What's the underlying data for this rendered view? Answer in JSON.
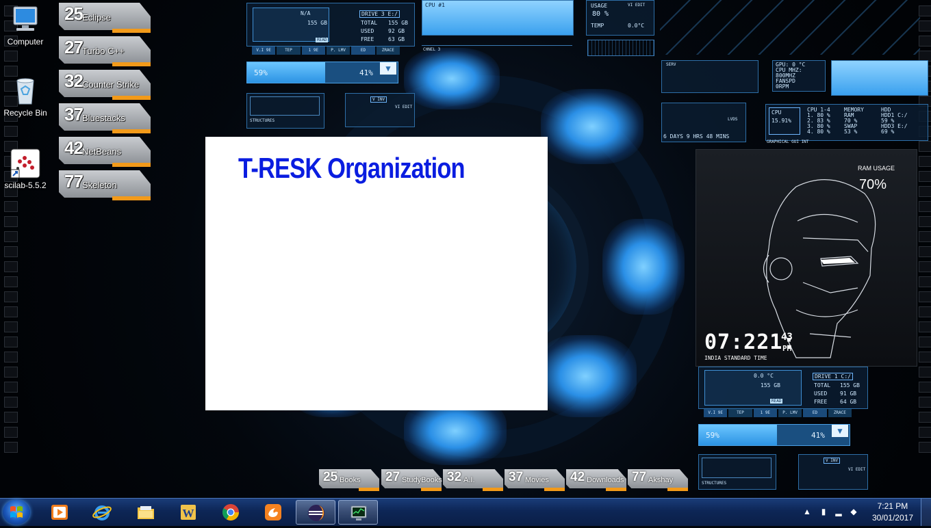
{
  "desktop_icons": [
    {
      "label": "Computer",
      "icon": "computer-icon"
    },
    {
      "label": "Recycle Bin",
      "icon": "recycle-bin-icon"
    },
    {
      "label": "scilab-5.5.2",
      "icon": "scilab-icon"
    }
  ],
  "left_tiles": [
    {
      "num": "25",
      "label": "Eclipse"
    },
    {
      "num": "27",
      "label": "Turbo C++"
    },
    {
      "num": "32",
      "label": "Counter Strike"
    },
    {
      "num": "37",
      "label": "Bluestacks"
    },
    {
      "num": "42",
      "label": "NetBeans"
    },
    {
      "num": "77",
      "label": "Skeleton"
    }
  ],
  "bottom_tiles": [
    {
      "num": "25",
      "label": "Books"
    },
    {
      "num": "27",
      "label": "StudyBooks"
    },
    {
      "num": "32",
      "label": "A.I."
    },
    {
      "num": "37",
      "label": "Movies"
    },
    {
      "num": "42",
      "label": "Downloads"
    },
    {
      "num": "77",
      "label": "Akshay"
    }
  ],
  "window": {
    "title": "T-RESK Organization"
  },
  "hud_top": {
    "drive": {
      "name": "DRIVE 3  E:/",
      "temp": "N/A",
      "size": "155 GB",
      "total_label": "TOTAL",
      "total": "155 GB",
      "used_label": "USED",
      "used": "92 GB",
      "free_label": "FREE",
      "free": "63 GB",
      "read": "READ"
    },
    "tabs": [
      "V.I 9E",
      "TEP",
      "1 9E",
      "P. LMV",
      "ED",
      "ZRACE"
    ],
    "bar_left": "59%",
    "bar_right": "41%",
    "structures": "STRUCTURES",
    "vi_inv": "V INV",
    "vi_edit": "VI EDIT",
    "cpu_label": "CPU #1",
    "channel": "CHNEL 3",
    "usage_label": "USAGE",
    "usage": "80 %",
    "temp_label": "TEMP",
    "temp": "0.0°C",
    "usage_vi": "VI EDIT"
  },
  "hud_right": {
    "gpu": [
      "GPU: 0 °C",
      "CPU MHZ:",
      "800MHZ",
      "FANSPD",
      "0RPM"
    ],
    "serv": "SERV",
    "uptime": "6 DAYS  9 HRS 48 MINS",
    "lvds": "LVDS",
    "cpu_label": "CPU",
    "cpu_value": "15.91%",
    "cores": [
      "CPU 1-4",
      "1.  80 %",
      "2.  83 %",
      "3.  80 %",
      "4.  80 %"
    ],
    "memory": [
      "MEMORY",
      "RAM",
      "70  %",
      "SWAP",
      "53  %"
    ],
    "hdd": [
      "HDD",
      "HDD1 C:/",
      "59  %",
      "HDD3 E:/",
      "69  %"
    ],
    "graphical": "GRAPHICAL GUI INT"
  },
  "ironman": {
    "ram_label": "RAM USAGE",
    "ram_value": "70%",
    "time_h": "07:2",
    "time_m": "21:",
    "time_s": "43",
    "ampm": "PM",
    "tz": "INDIA STANDARD TIME"
  },
  "hud_bottom": {
    "drive": {
      "name": "DRIVE 1  C:/",
      "temp": "0.0 °C",
      "size": "155 GB",
      "total_label": "TOTAL",
      "total": "155 GB",
      "used_label": "USED",
      "used": "91 GB",
      "free_label": "FREE",
      "free": "64 GB",
      "read": "READ"
    },
    "tabs": [
      "V.I 9E",
      "TEP",
      "1 9E",
      "P. LMV",
      "ED",
      "ZRACE"
    ],
    "bar_left": "59%",
    "bar_right": "41%",
    "structures": "STRUCTURES",
    "vi_inv": "V INV",
    "vi_edit": "VI EDIT"
  },
  "taskbar": {
    "pinned": [
      {
        "icon": "windows-media-player-icon"
      },
      {
        "icon": "internet-explorer-icon"
      },
      {
        "icon": "file-explorer-icon"
      },
      {
        "icon": "microsoft-word-icon"
      },
      {
        "icon": "chrome-icon"
      },
      {
        "icon": "uc-browser-icon"
      },
      {
        "icon": "eclipse-icon"
      },
      {
        "icon": "task-manager-icon"
      }
    ],
    "time": "7:21 PM",
    "date": "30/01/2017"
  }
}
